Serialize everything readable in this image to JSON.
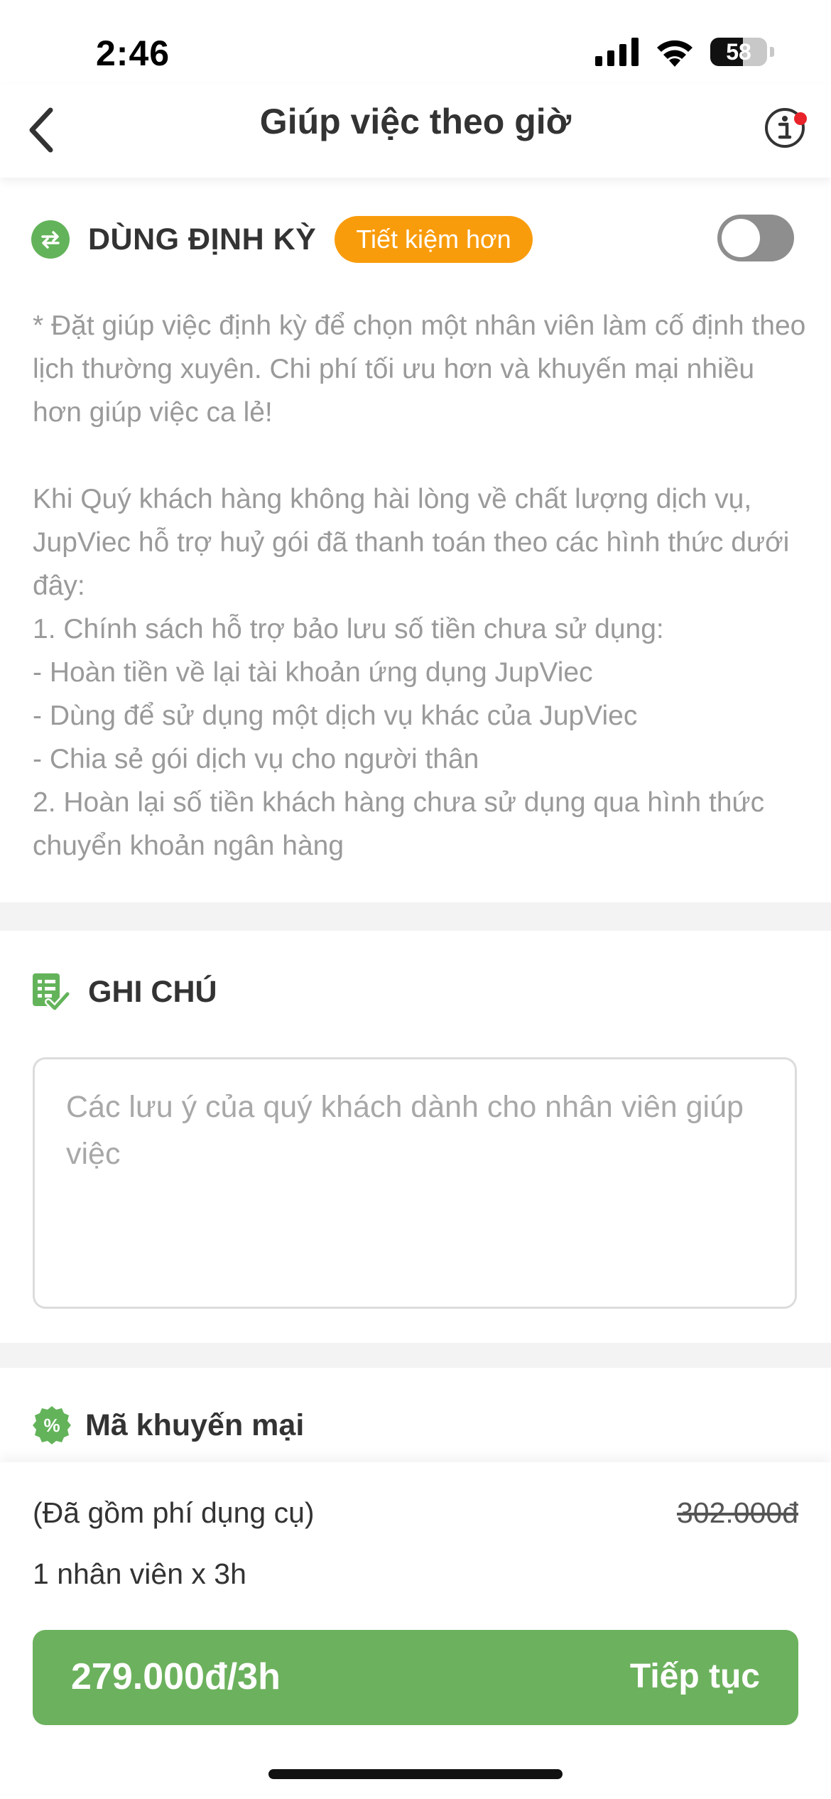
{
  "status_bar": {
    "time": "2:46",
    "battery_level": 58,
    "battery_text": "58"
  },
  "nav": {
    "title": "Giúp việc theo giờ"
  },
  "recurring": {
    "title": "DÙNG ĐỊNH KỲ",
    "badge": "Tiết kiệm hơn",
    "toggle_on": false,
    "desc_1": "* Đặt giúp việc định kỳ để chọn một nhân viên làm cố định theo lịch thường xuyên. Chi phí tối ưu hơn và khuyến mại nhiều hơn giúp việc ca lẻ!",
    "desc_2": "Khi Quý khách hàng không hài lòng về chất lượng dịch vụ, JupViec hỗ trợ huỷ gói đã thanh toán theo các hình thức dưới đây:",
    "desc_3": "1. Chính sách hỗ trợ bảo lưu số tiền chưa sử dụng:",
    "desc_4": "- Hoàn tiền về lại tài khoản ứng dụng JupViec",
    "desc_5": "- Dùng để sử dụng một dịch vụ khác của JupViec",
    "desc_6": "- Chia sẻ gói dịch vụ cho người thân",
    "desc_7": "2. Hoàn lại số tiền khách hàng chưa sử dụng qua hình thức chuyển khoản ngân hàng"
  },
  "note": {
    "title": "GHI CHÚ",
    "value": "",
    "placeholder": "Các lưu ý của quý khách dành cho nhân viên giúp việc"
  },
  "promo": {
    "title": "Mã khuyến mại",
    "icon_glyph": "%"
  },
  "summary": {
    "fee_note": "(Đã gồm phí dụng cụ)",
    "old_price": "302.000đ",
    "staff_info": "1 nhân viên x 3h",
    "price": "279.000đ/3h",
    "continue_label": "Tiếp tục"
  },
  "colors": {
    "accent_green": "#6cb15d",
    "badge_orange": "#f99c0c",
    "notification_red": "#e8232a"
  }
}
